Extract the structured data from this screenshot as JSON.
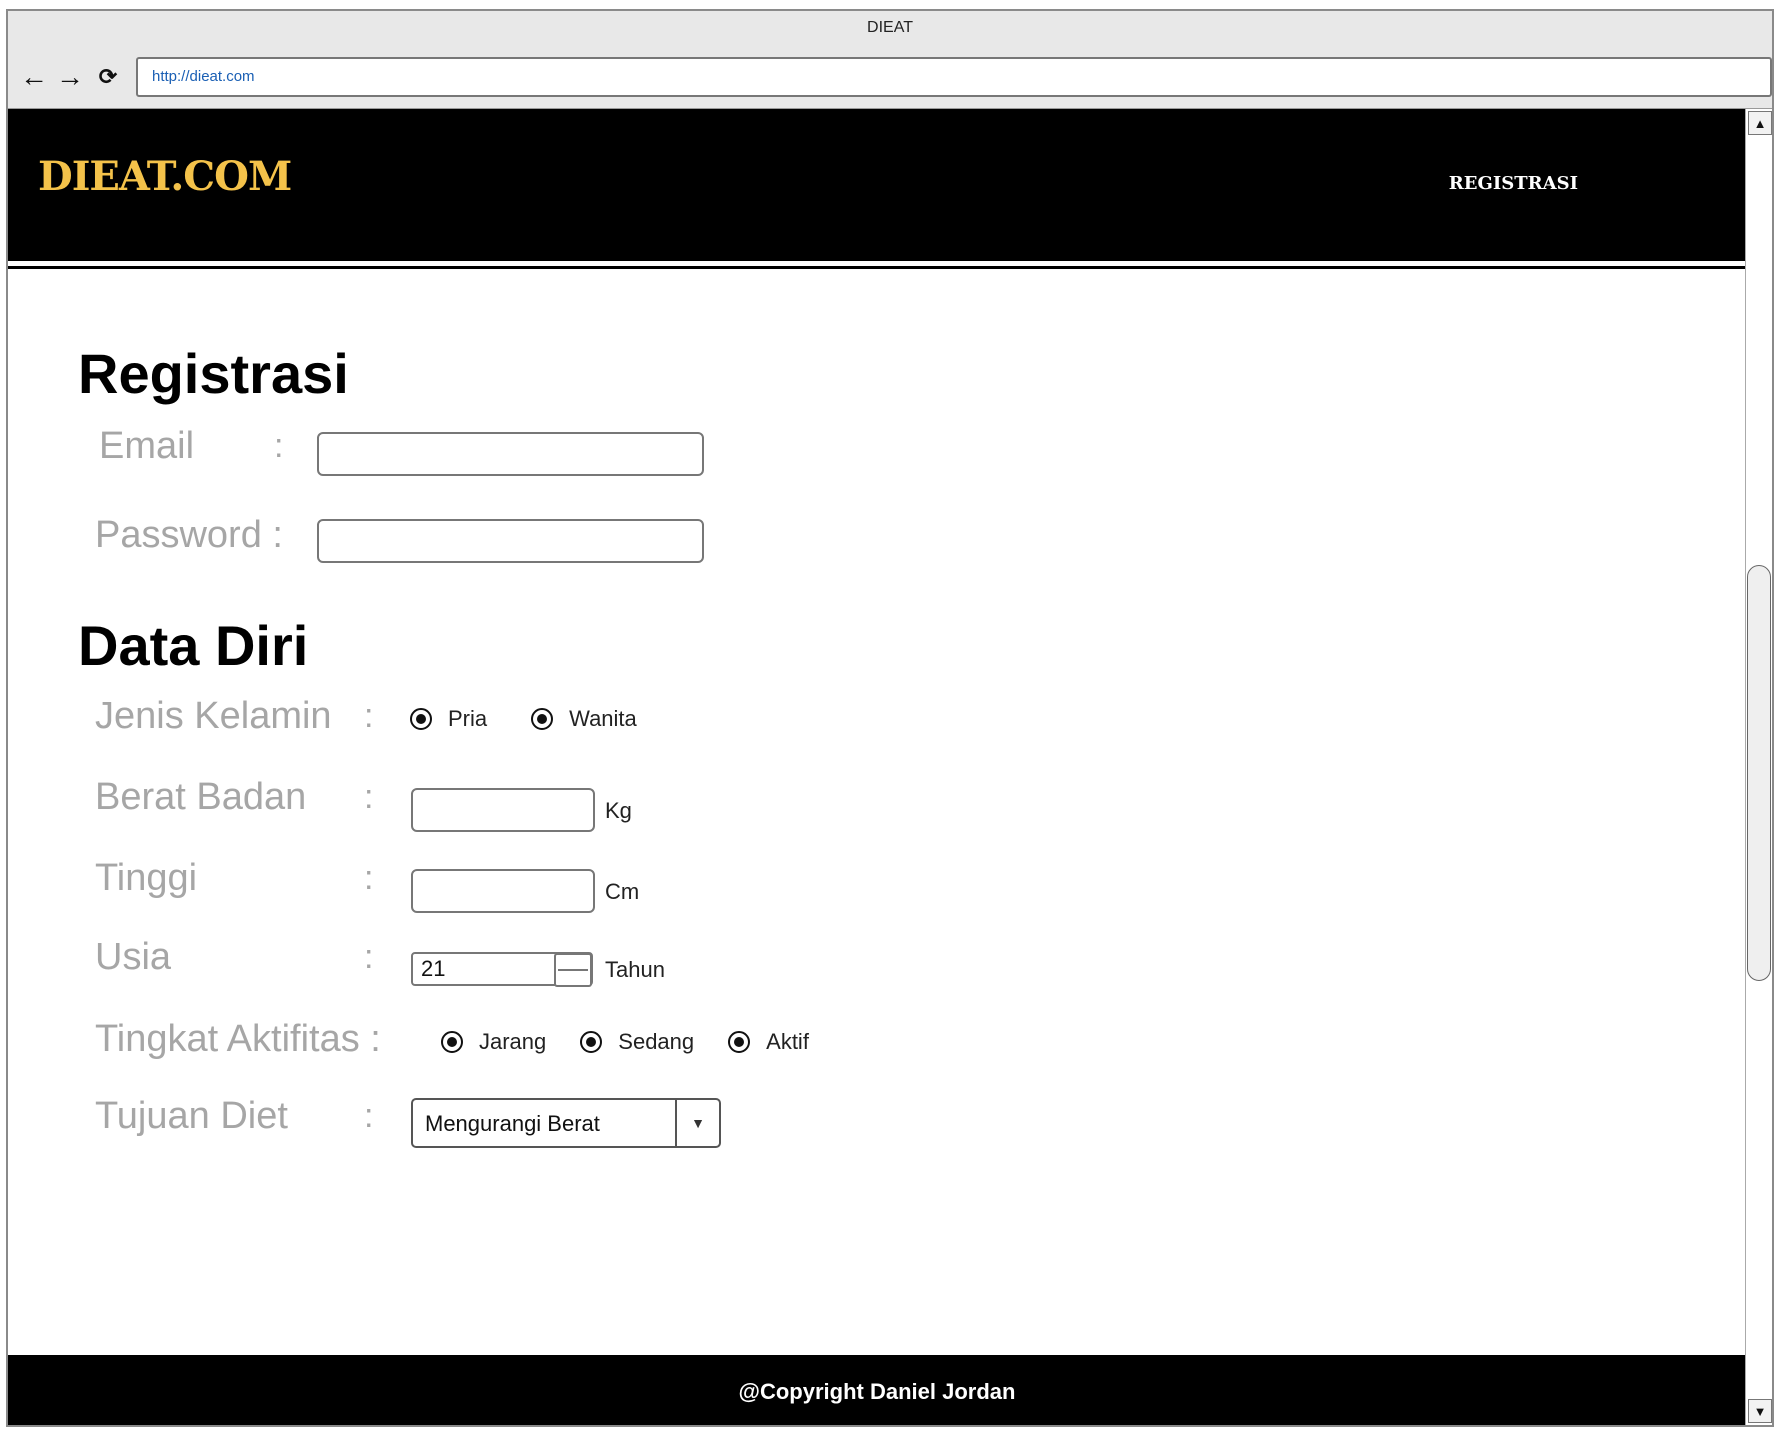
{
  "window": {
    "title": "DIEAT"
  },
  "browser": {
    "url": "http://dieat.com",
    "back_icon": "arrow-left-icon",
    "forward_icon": "arrow-right-icon",
    "reload_icon": "reload-icon"
  },
  "header": {
    "logo": "DIEAT.COM",
    "nav_link": "REGISTRASI",
    "logo_color": "#f4c24a",
    "background": "#000000"
  },
  "registration": {
    "title": "Registrasi",
    "email_label": "Email",
    "password_label": "Password :",
    "email_value": "",
    "password_value": ""
  },
  "personal": {
    "title": "Data Diri",
    "gender_label": "Jenis Kelamin",
    "gender_options": [
      "Pria",
      "Wanita"
    ],
    "weight_label": "Berat Badan",
    "weight_unit": "Kg",
    "height_label": "Tinggi",
    "height_unit": "Cm",
    "age_label": "Usia",
    "age_value": "21",
    "age_unit": "Tahun",
    "activity_label": "Tingkat Aktifitas :",
    "activity_options": [
      "Jarang",
      "Sedang",
      "Aktif"
    ],
    "goal_label": "Tujuan Diet",
    "goal_value": "Mengurangi Berat"
  },
  "colon": ":",
  "footer": {
    "text": "@Copyright Daniel Jordan"
  }
}
